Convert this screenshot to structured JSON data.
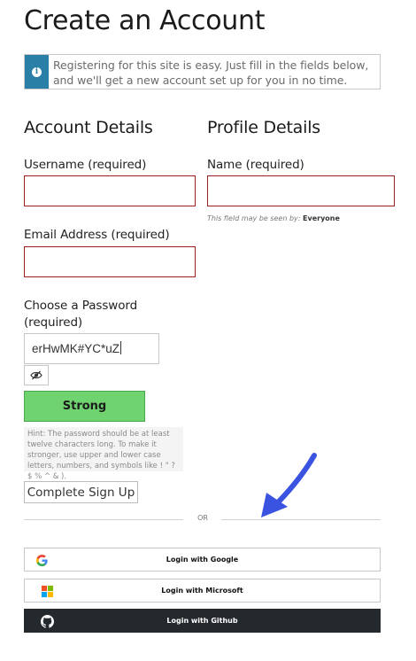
{
  "page": {
    "title": "Create an Account"
  },
  "notice": {
    "icon": "info-icon",
    "text_line1": "Registering for this site is easy. Just fill in the fields below,",
    "text_line2": "and we'll get a new account set up for you in no time."
  },
  "account": {
    "heading": "Account Details",
    "username_label": "Username (required)",
    "username_value": "",
    "email_label": "Email Address (required)",
    "email_value": "",
    "password_label_line1": "Choose a Password",
    "password_label_line2": "(required)",
    "password_value": "erHwMK#YC*uZ",
    "password_toggle_icon": "eye-off-icon",
    "strength": "Strong",
    "strength_color": "#6fd36f",
    "hint": "Hint: The password should be at least twelve characters long. To make it stronger, use upper and lower case letters, numbers, and symbols like ! \" ? $ % ^ & ).",
    "submit_label": "Complete Sign Up"
  },
  "profile": {
    "heading": "Profile Details",
    "name_label": "Name (required)",
    "name_value": "",
    "visibility_prefix": "This field may be seen by:",
    "visibility_value": "Everyone"
  },
  "divider": {
    "text": "OR"
  },
  "social": {
    "google": {
      "label": "Login with Google",
      "icon": "google-icon"
    },
    "microsoft": {
      "label": "Login with Microsoft",
      "icon": "microsoft-icon"
    },
    "github": {
      "label": "Login with Github",
      "icon": "github-icon"
    }
  },
  "colors": {
    "accent": "#2a7fa6",
    "error_border": "#9a1f1f",
    "annotation_arrow": "#3a53e0",
    "github_bg": "#24292e"
  }
}
